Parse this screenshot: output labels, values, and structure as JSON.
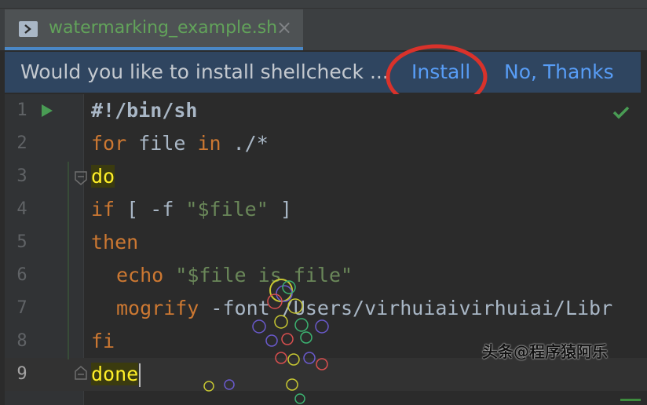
{
  "tab": {
    "filename": "watermarking_example.sh",
    "close_label": "×"
  },
  "notification": {
    "message": "Would you like to install shellcheck ...",
    "install_label": "Install",
    "decline_label": "No, Thanks"
  },
  "editor": {
    "line_numbers": [
      "1",
      "2",
      "3",
      "4",
      "5",
      "6",
      "7",
      "8",
      "9"
    ],
    "current_line": 9,
    "lines": {
      "l1": "#!/bin/sh",
      "l2_kw1": "for",
      "l2_mid": " file ",
      "l2_kw2": "in",
      "l2_end": " ./*",
      "l3": "do",
      "l4_kw": "if",
      "l4_mid": " [ -f ",
      "l4_str": "\"$file\"",
      "l4_end": " ]",
      "l5": "then",
      "l6_kw": "echo",
      "l6_str": "\"$file is file\"",
      "l7_kw": "mogrify",
      "l7_rest": " -font /Users/virhuiaivirhuiai/Libr",
      "l8": "fi",
      "l9": "done"
    }
  },
  "watermark": "头条@程序猿阿乐",
  "icons": {
    "file_type": "shell-script-icon",
    "run": "run-gutter-icon",
    "fold": "fold-marker-icon",
    "inspection": "checkmark-icon"
  },
  "colors": {
    "keyword": "#cc7832",
    "string": "#6a8759",
    "link": "#589df6",
    "highlight": "#ffef28",
    "annotation_circle": "#d9322b"
  }
}
